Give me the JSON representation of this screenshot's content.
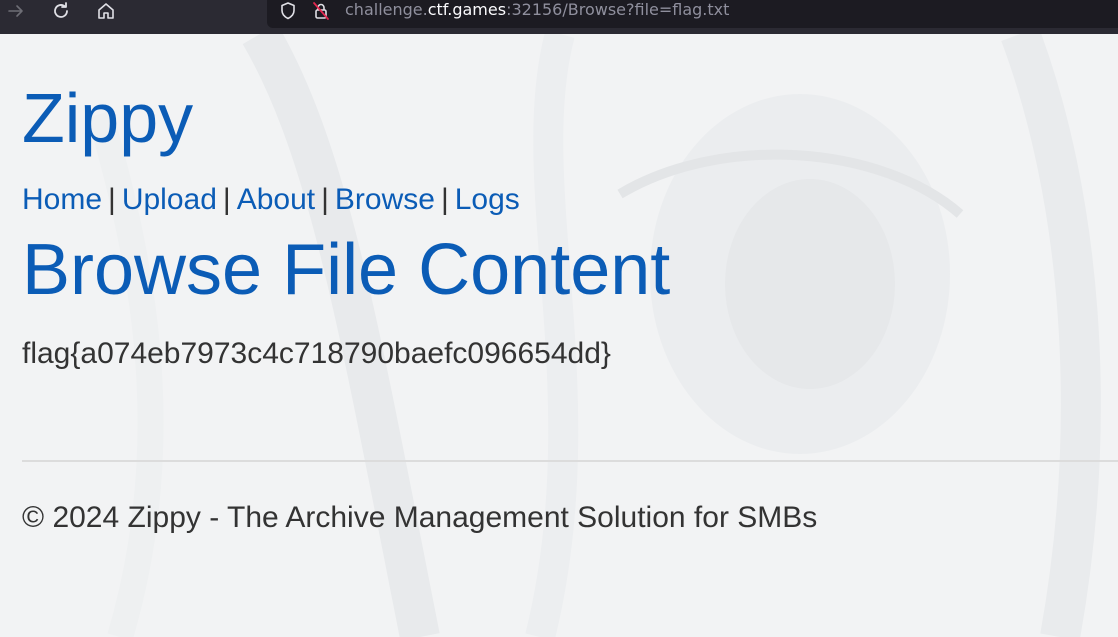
{
  "browser": {
    "url_prefix": "challenge.",
    "url_host": "ctf.games",
    "url_suffix": ":32156/Browse?file=flag.txt"
  },
  "site": {
    "title": "Zippy"
  },
  "nav": {
    "items": [
      {
        "label": "Home"
      },
      {
        "label": "Upload"
      },
      {
        "label": "About"
      },
      {
        "label": "Browse"
      },
      {
        "label": "Logs"
      }
    ],
    "separator": "|"
  },
  "main": {
    "heading": "Browse File Content",
    "file_content": "flag{a074eb7973c4c718790baefc096654dd}"
  },
  "footer": {
    "text": "© 2024 Zippy - The Archive Management Solution for SMBs"
  },
  "colors": {
    "link": "#0b5cb6",
    "text": "#333333",
    "toolbar_bg": "#2b2a33"
  }
}
